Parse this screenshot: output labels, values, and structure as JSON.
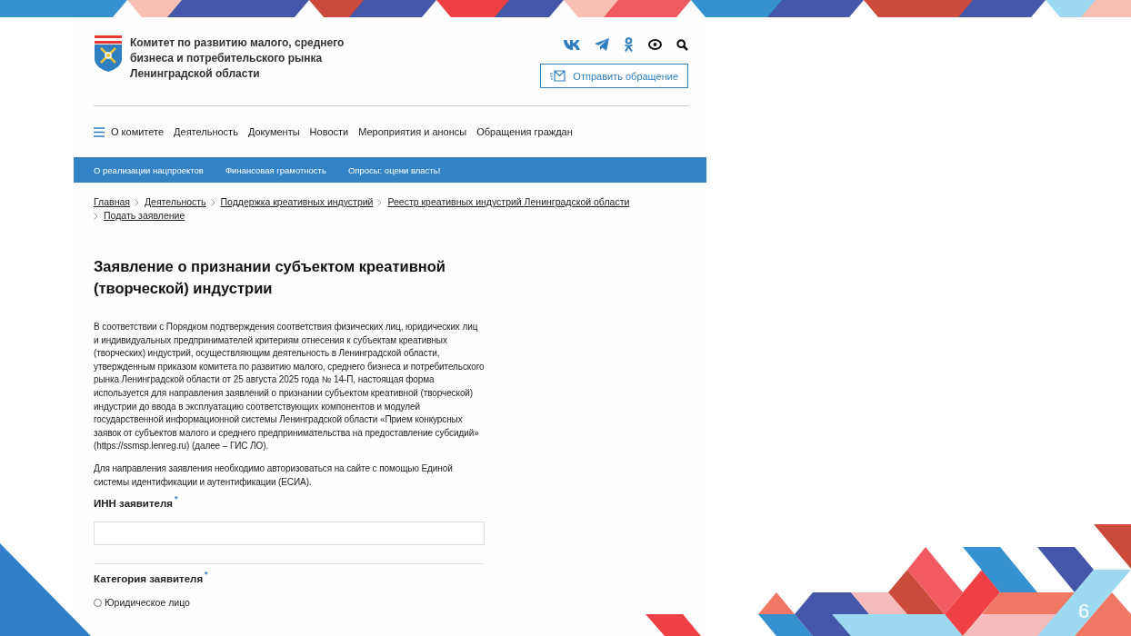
{
  "header": {
    "org_name_lines": [
      "Комитет по развитию малого, среднего",
      "бизнеса и потребительского рынка",
      "Ленинградской области"
    ],
    "appeal_button": "Отправить обращение"
  },
  "main_menu": [
    "О комитете",
    "Деятельность",
    "Документы",
    "Новости",
    "Мероприятия и анонсы",
    "Обращения граждан"
  ],
  "sub_menu": [
    "О реализации нацпроектов",
    "Финансовая грамотность",
    "Опросы: оцени власть!"
  ],
  "breadcrumbs": [
    "Главная",
    "Деятельность",
    "Поддержка креативных индустрий",
    "Реестр креативных индустрий Ленинградской области",
    "Подать заявление"
  ],
  "title": "Заявление о признании субъектом креативной (творческой) индустрии",
  "paragraphs": [
    "В соответствии с Порядком подтверждения соответствия физических лиц, юридических лиц и индивидуальных предпринимателей критериям отнесения к субъектам креативных (творческих) индустрий, осуществляющим деятельность в Ленинградской области, утвержденным приказом комитета по развитию малого, среднего бизнеса и потребительского рынка Ленинградской области от 25 августа 2025 года № 14-П, настоящая форма используется для направления заявлений о признании субъектом креативной (творческой) индустрии до ввода в эксплуатацию соответствующих компонентов и модулей государственной информационной системы Ленинградской области «Прием конкурсных заявок от субъектов малого и среднего предпринимательства на предоставление субсидий» (https://ssmsp.lenreg.ru) (далее – ГИС ЛО).",
    "Для направления заявления необходимо авторизоваться на сайте с помощью Единой системы идентификации и аутентификации (ЕСИА)."
  ],
  "form": {
    "fields": [
      {
        "kind": "text",
        "label": "ИНН заявителя",
        "required_mark": "*"
      },
      {
        "kind": "radio",
        "label": "Категория заявителя",
        "required_mark": "*",
        "options": [
          {
            "label": "Юридическое лицо",
            "selected": false
          }
        ]
      }
    ]
  },
  "slide": {
    "page_number": "6"
  }
}
